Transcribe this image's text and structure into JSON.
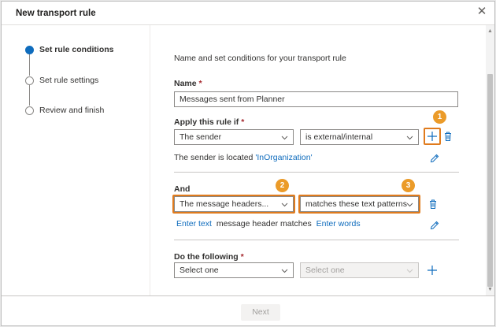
{
  "dialog": {
    "title": "New transport rule"
  },
  "steps": [
    {
      "label": "Set rule conditions",
      "active": true
    },
    {
      "label": "Set rule settings",
      "active": false
    },
    {
      "label": "Review and finish",
      "active": false
    }
  ],
  "form": {
    "intro": "Name and set conditions for your transport rule",
    "name_label": "Name",
    "name_value": "Messages sent from Planner",
    "apply_label": "Apply this rule if",
    "apply_dropdown_1": "The sender",
    "apply_dropdown_2": "is external/internal",
    "apply_desc_prefix": "The sender is located ",
    "apply_desc_link": "'InOrganization'",
    "and_label": "And",
    "and_dropdown_1": "The message headers...",
    "and_dropdown_2": "matches these text patterns",
    "and_link_1": "Enter text",
    "and_middle": "message header matches",
    "and_link_2": "Enter words",
    "do_label": "Do the following",
    "do_dropdown_1": "Select one",
    "do_dropdown_2": "Select one",
    "required_mark": "*"
  },
  "callouts": [
    "1",
    "2",
    "3"
  ],
  "footer": {
    "next_label": "Next"
  },
  "colors": {
    "accent": "#0f6cbd",
    "highlight": "#e07b1d",
    "badge": "#eb9b29",
    "required": "#a4262c"
  },
  "icons": {
    "close": "close-icon",
    "add": "plus-icon",
    "delete": "trash-icon",
    "edit": "pencil-icon",
    "chevron": "chevron-down-icon"
  }
}
